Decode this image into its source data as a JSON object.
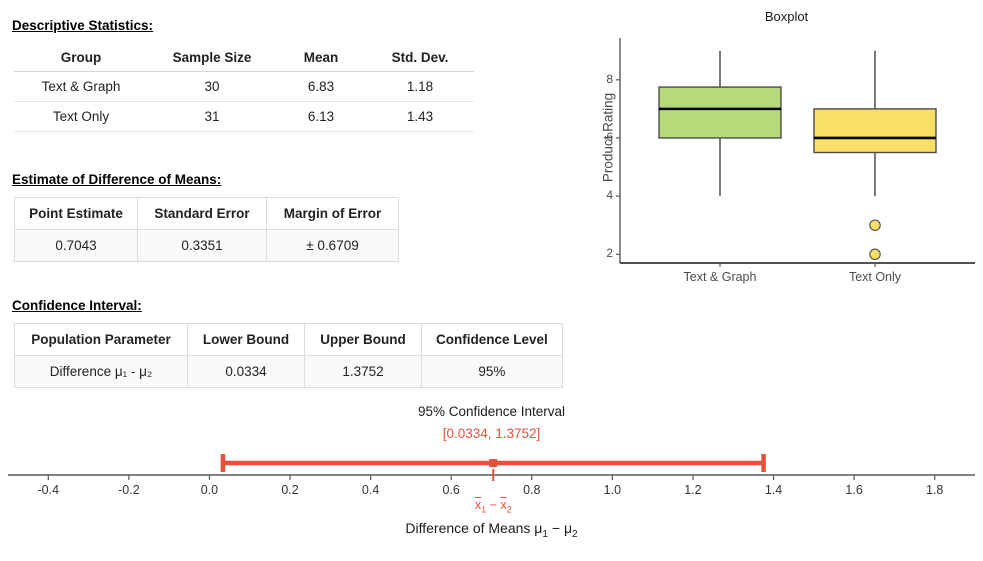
{
  "descriptive": {
    "heading": "Descriptive Statistics:",
    "columns": [
      "Group",
      "Sample Size",
      "Mean",
      "Std. Dev."
    ],
    "rows": [
      [
        "Text & Graph",
        "30",
        "6.83",
        "1.18"
      ],
      [
        "Text Only",
        "31",
        "6.13",
        "1.43"
      ]
    ]
  },
  "estimate": {
    "heading": "Estimate of Difference of Means:",
    "columns": [
      "Point Estimate",
      "Standard Error",
      "Margin of Error"
    ],
    "rows": [
      [
        "0.7043",
        "0.3351",
        "± 0.6709"
      ]
    ]
  },
  "confidence_table": {
    "heading": "Confidence Interval:",
    "columns": [
      "Population Parameter",
      "Lower Bound",
      "Upper Bound",
      "Confidence Level"
    ],
    "rows": [
      [
        "Difference μ₁ - μ₂",
        "0.0334",
        "1.3752",
        "95%"
      ]
    ]
  },
  "colors": {
    "group_a_fill": "#b5db78",
    "group_b_fill": "#fadf66",
    "box_stroke": "#4d4d4d",
    "median_stroke": "#000000",
    "whisker_stroke": "#4d4d4d",
    "outlier_fill": "#fadf66",
    "ci_accent": "#e8503a",
    "axis": "#595959"
  },
  "chart_data": [
    {
      "type": "boxplot",
      "title": "Boxplot",
      "xlabel": "",
      "ylabel": "Product Rating",
      "ylim": [
        1.7,
        9.3
      ],
      "yticks": [
        2,
        4,
        6,
        8
      ],
      "categories": [
        "Text & Graph",
        "Text Only"
      ],
      "grid": false,
      "series": [
        {
          "name": "Text & Graph",
          "color": "#b5db78",
          "min": 4.0,
          "q1": 6.0,
          "median": 7.0,
          "q3": 7.75,
          "max": 9.0,
          "outliers": []
        },
        {
          "name": "Text Only",
          "color": "#fadf66",
          "min": 4.0,
          "q1": 5.5,
          "median": 6.0,
          "q3": 7.0,
          "max": 9.0,
          "outliers": [
            3.0,
            2.0
          ]
        }
      ]
    },
    {
      "type": "interval",
      "title": "95% Confidence Interval",
      "range_label": "[0.0334, 1.3752]",
      "xlabel": "Difference of Means μ₁ − μ₂",
      "center_label": "x̄1 − x̄2",
      "xlim": [
        -0.5,
        1.9
      ],
      "xticks": [
        -0.4,
        -0.2,
        0.0,
        0.2,
        0.4,
        0.6,
        0.8,
        1.0,
        1.2,
        1.4,
        1.6,
        1.8
      ],
      "xticklabels": [
        "-0.4",
        "-0.2",
        "0.0",
        "0.2",
        "0.4",
        "0.6",
        "0.8",
        "1.0",
        "1.2",
        "1.4",
        "1.6",
        "1.8"
      ],
      "lower": 0.0334,
      "upper": 1.3752,
      "point_estimate": 0.7043,
      "color": "#e8503a"
    }
  ]
}
